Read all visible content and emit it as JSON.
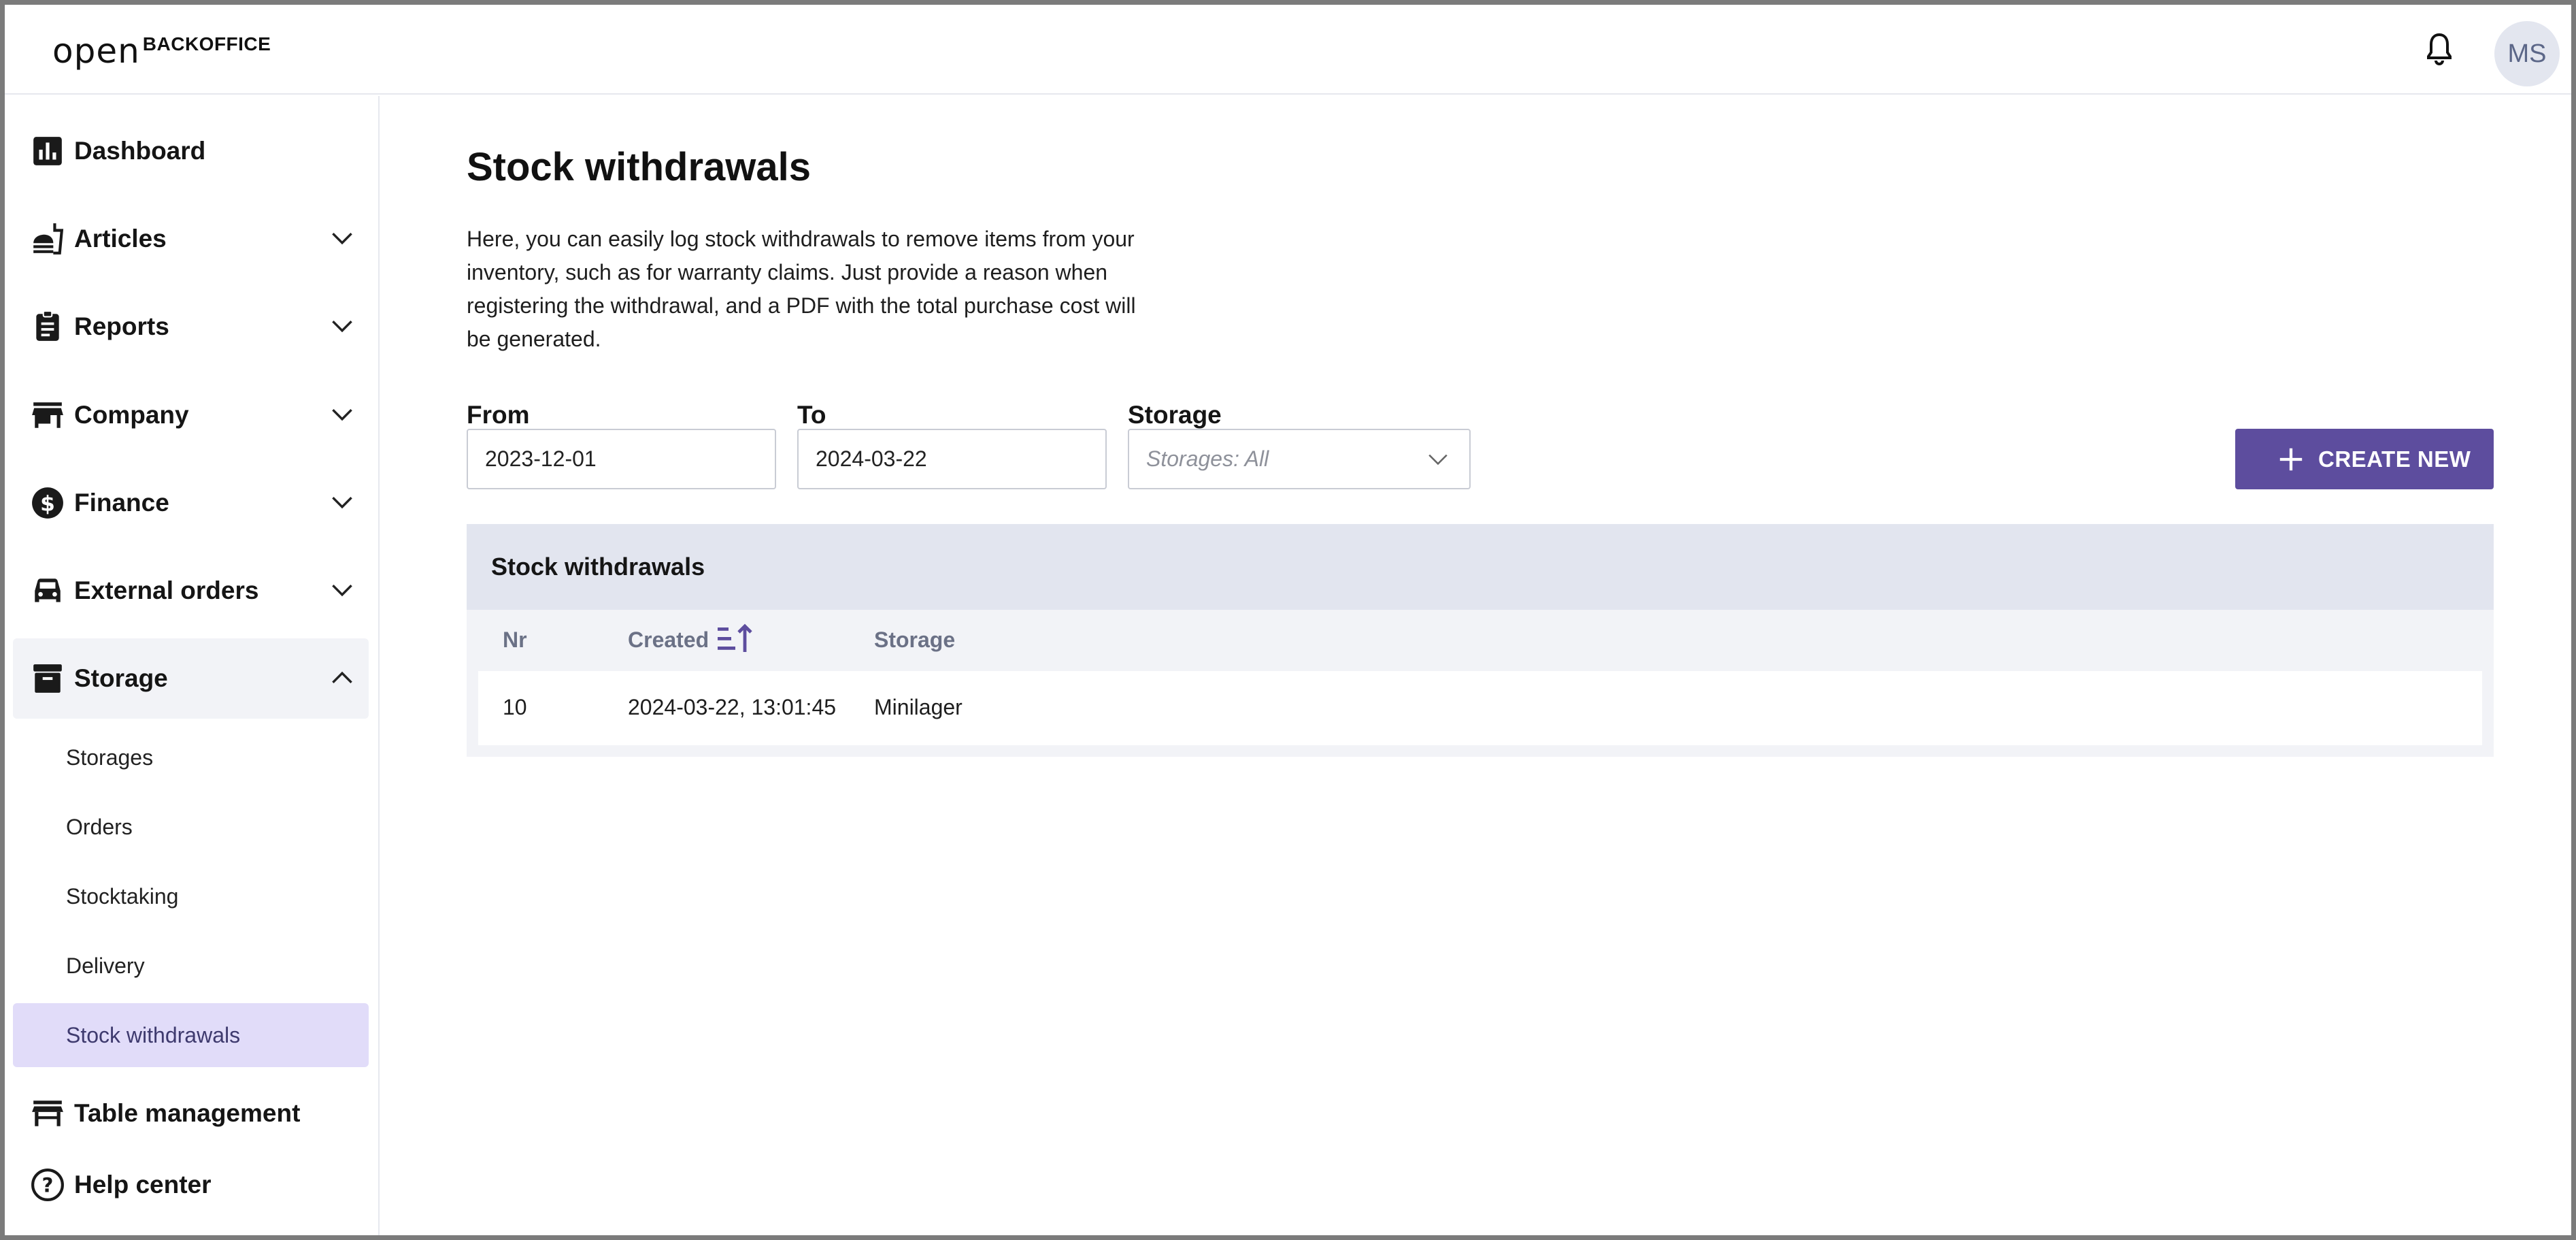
{
  "header": {
    "logo_mark": "open",
    "logo_text": "BACKOFFICE",
    "avatar_initials": "MS"
  },
  "sidebar": {
    "items": [
      {
        "label": "Dashboard",
        "icon": "bar-chart-icon"
      },
      {
        "label": "Articles",
        "icon": "food-icon"
      },
      {
        "label": "Reports",
        "icon": "clipboard-icon"
      },
      {
        "label": "Company",
        "icon": "store-icon"
      },
      {
        "label": "Finance",
        "icon": "dollar-icon"
      },
      {
        "label": "External orders",
        "icon": "car-icon"
      },
      {
        "label": "Storage",
        "icon": "archive-icon"
      }
    ],
    "storage_sub": [
      {
        "label": "Storages"
      },
      {
        "label": "Orders"
      },
      {
        "label": "Stocktaking"
      },
      {
        "label": "Delivery"
      },
      {
        "label": "Stock withdrawals"
      }
    ],
    "table_management": "Table management",
    "help_center": "Help center"
  },
  "main": {
    "title": "Stock withdrawals",
    "description": "Here, you can easily log stock withdrawals to remove items from your inventory, such as for warranty claims. Just provide a reason when registering the withdrawal, and a PDF with the total purchase cost will be generated.",
    "filters": {
      "from_label": "From",
      "from_value": "2023-12-01",
      "to_label": "To",
      "to_value": "2024-03-22",
      "storage_label": "Storage",
      "storage_placeholder": "Storages: All"
    },
    "create_button": "CREATE NEW",
    "accent_color": "#5d4d9e",
    "table": {
      "title": "Stock withdrawals",
      "columns": [
        "Nr",
        "Created",
        "Storage"
      ],
      "rows": [
        {
          "nr": "10",
          "created": "2024-03-22, 13:01:45",
          "storage": "Minilager"
        }
      ]
    }
  }
}
